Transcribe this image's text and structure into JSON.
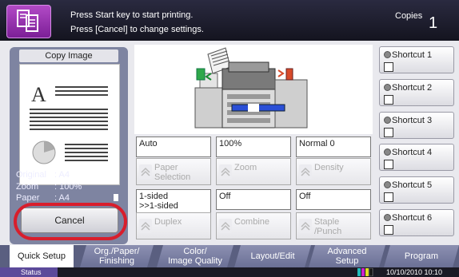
{
  "header": {
    "message_line1": "Press Start key to start printing.",
    "message_line2": "Press [Cancel] to change settings.",
    "copies_label": "Copies",
    "copies_value": "1"
  },
  "preview": {
    "title": "Copy Image",
    "original_label": "Original",
    "original_value": ": A4",
    "zoom_label": "Zoom",
    "zoom_value": ": 100%",
    "paper_label": "Paper",
    "paper_value": ": A4",
    "cancel_label": "Cancel"
  },
  "functions": {
    "paper": {
      "value": "Auto",
      "label_line1": "Paper",
      "label_line2": "Selection"
    },
    "zoom": {
      "value": "100%",
      "label_line1": "Zoom",
      "label_line2": ""
    },
    "density": {
      "value": "Normal 0",
      "label_line1": "Density",
      "label_line2": ""
    },
    "duplex": {
      "value_line1": "1-sided",
      "value_line2": ">>1-sided",
      "label_line1": "Duplex",
      "label_line2": ""
    },
    "combine": {
      "value": "Off",
      "label_line1": "Combine",
      "label_line2": ""
    },
    "staple": {
      "value": "Off",
      "label_line1": "Staple",
      "label_line2": "/Punch"
    }
  },
  "shortcuts": [
    {
      "label": "Shortcut 1"
    },
    {
      "label": "Shortcut 2"
    },
    {
      "label": "Shortcut 3"
    },
    {
      "label": "Shortcut 4"
    },
    {
      "label": "Shortcut 5"
    },
    {
      "label": "Shortcut 6"
    }
  ],
  "tabs": [
    {
      "line1": "Quick Setup",
      "line2": ""
    },
    {
      "line1": "Org./Paper/",
      "line2": "Finishing"
    },
    {
      "line1": "Color/",
      "line2": "Image Quality"
    },
    {
      "line1": "Layout/Edit",
      "line2": ""
    },
    {
      "line1": "Advanced",
      "line2": "Setup"
    },
    {
      "line1": "Program",
      "line2": ""
    }
  ],
  "status": {
    "button_label": "Status",
    "datetime": "10/10/2010 10:10"
  },
  "colors": {
    "header_bg": "#1e1e2e",
    "panel_bg": "#7e84a1",
    "highlight_ring": "#d81e2c",
    "status_button": "#5c4a9a"
  },
  "icons": {
    "header": "copy-mode-icon",
    "shortcut": "shortcut-register-icon",
    "function": "expand-up-icon"
  }
}
